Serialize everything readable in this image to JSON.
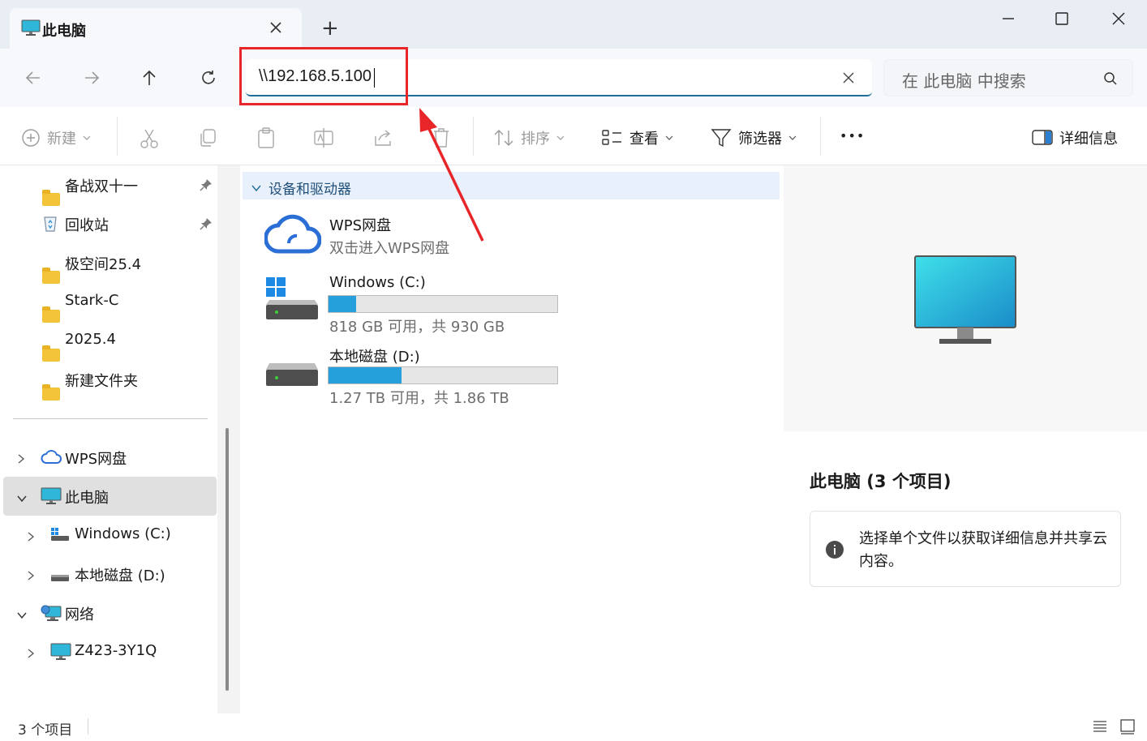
{
  "window": {
    "tab_title": "此电脑",
    "new_tab": "+",
    "controls": [
      "minimize",
      "maximize",
      "close"
    ]
  },
  "nav": {
    "address_value": "\\\\192.168.5.100",
    "search_placeholder": "在 此电脑 中搜索"
  },
  "toolbar": {
    "new_label": "新建",
    "sort_label": "排序",
    "view_label": "查看",
    "filter_label": "筛选器",
    "more_label": "•••",
    "details_label": "详细信息"
  },
  "sidebar": {
    "quick": [
      {
        "label": "备战双十一",
        "icon": "folder-icon",
        "pinned": true
      },
      {
        "label": "回收站",
        "icon": "recycle-bin-icon",
        "pinned": true
      },
      {
        "label": "极空间25.4",
        "icon": "folder-icon"
      },
      {
        "label": "Stark-C",
        "icon": "folder-icon"
      },
      {
        "label": "2025.4",
        "icon": "folder-icon"
      },
      {
        "label": "新建文件夹",
        "icon": "folder-icon"
      }
    ],
    "tree": [
      {
        "label": "WPS网盘",
        "icon": "cloud-icon"
      },
      {
        "label": "此电脑",
        "icon": "computer-icon"
      },
      {
        "label": "Windows (C:)",
        "icon": "windows-drive-icon"
      },
      {
        "label": "本地磁盘 (D:)",
        "icon": "drive-icon"
      },
      {
        "label": "网络",
        "icon": "network-icon"
      },
      {
        "label": "Z423-3Y1Q",
        "icon": "computer-icon"
      }
    ]
  },
  "main": {
    "group_title": "设备和驱动器",
    "items": [
      {
        "name": "WPS网盘",
        "sub": "双击进入WPS网盘"
      },
      {
        "name": "Windows (C:)",
        "sub": "818 GB 可用，共 930 GB",
        "used_fraction": 0.12
      },
      {
        "name": "本地磁盘 (D:)",
        "sub": "1.27 TB 可用，共 1.86 TB",
        "used_fraction": 0.32
      }
    ]
  },
  "details": {
    "title": "此电脑 (3 个项目)",
    "info": "选择单个文件以获取详细信息并共享云内容。"
  },
  "status": {
    "count": "3 个项目"
  },
  "colors": {
    "accent": "#1f6f98",
    "annotation": "#e8262a",
    "storage_bar": "#26a0da"
  }
}
